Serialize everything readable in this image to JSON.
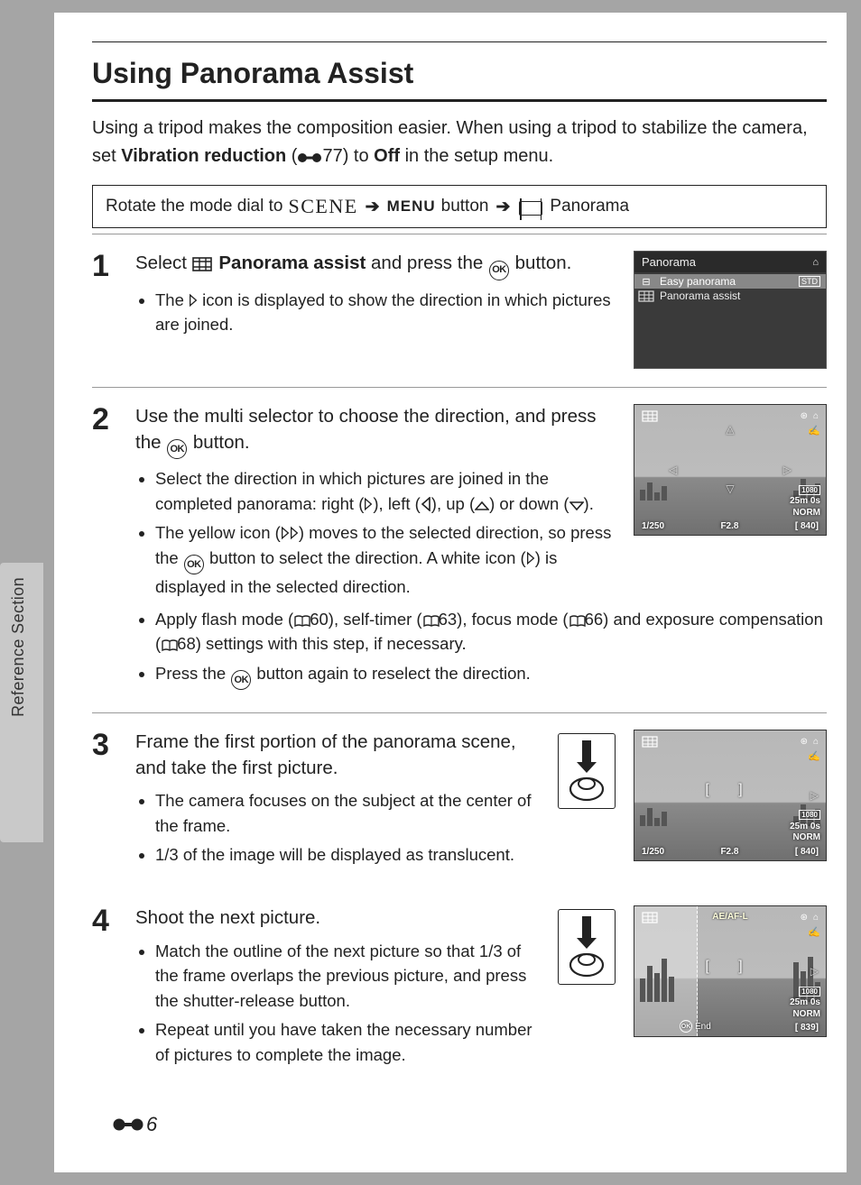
{
  "side_label": "Reference Section",
  "heading": "Using Panorama Assist",
  "intro_pre": "Using a tripod makes the composition easier. When using a tripod to stabilize the camera, set ",
  "intro_vr": "Vibration reduction",
  "intro_ref": "77) to ",
  "intro_off": "Off",
  "intro_post": " in the setup menu.",
  "nav_pre": "Rotate the mode dial to ",
  "nav_scene": "SCENE",
  "nav_menu": "MENU",
  "nav_btn": " button ",
  "nav_pano": " Panorama",
  "steps": {
    "s1": {
      "num": "1",
      "head_pre": "Select ",
      "head_bold": " Panorama assist",
      "head_mid": " and press the ",
      "head_post": " button.",
      "b1_pre": "The ",
      "b1_post": " icon is displayed to show the direction in which pictures are joined."
    },
    "s2": {
      "num": "2",
      "head_pre": "Use the multi selector to choose the direction, and press the ",
      "head_post": " button.",
      "b1_pre": "Select the direction in which pictures are joined in the completed panorama: right (",
      "b1_l": "), left (",
      "b1_u": "), up (",
      "b1_d": ") or down (",
      "b1_end": ").",
      "b2_pre": "The yellow icon (",
      "b2_mid": ") moves to the selected direction, so press the ",
      "b2_mid2": " button to select the direction. A white icon (",
      "b2_end": ") is displayed in the selected direction.",
      "b3_pre": "Apply flash mode (",
      "b3_r1": "60), self-timer (",
      "b3_r2": "63), focus mode (",
      "b3_r3": "66) and exposure compensation (",
      "b3_r4": "68) settings with this step, if necessary.",
      "b4_pre": "Press the ",
      "b4_post": " button again to reselect the direction."
    },
    "s3": {
      "num": "3",
      "head": "Frame the first portion of the panorama scene, and take the first picture.",
      "b1": "The camera focuses on the subject at the center of the frame.",
      "b2": "1/3 of the image will be displayed as translucent."
    },
    "s4": {
      "num": "4",
      "head": "Shoot the next picture.",
      "b1": "Match the outline of the next picture so that 1/3 of the frame overlaps the previous picture, and press the shutter-release button.",
      "b2": "Repeat until you have taken the necessary number of pictures to complete the image."
    }
  },
  "lcd": {
    "title": "Panorama",
    "item1": "Easy panorama",
    "item1_badge": "STD",
    "item2": "Panorama assist"
  },
  "vf": {
    "shutter": "1/250",
    "aperture": "F2.8",
    "shots": "[ 840]",
    "shots2": "[ 839]",
    "time": "25m 0s",
    "norm": "NORM",
    "res": "1080",
    "ael": "AE/AF-L",
    "end": "End"
  },
  "page_number": "6"
}
